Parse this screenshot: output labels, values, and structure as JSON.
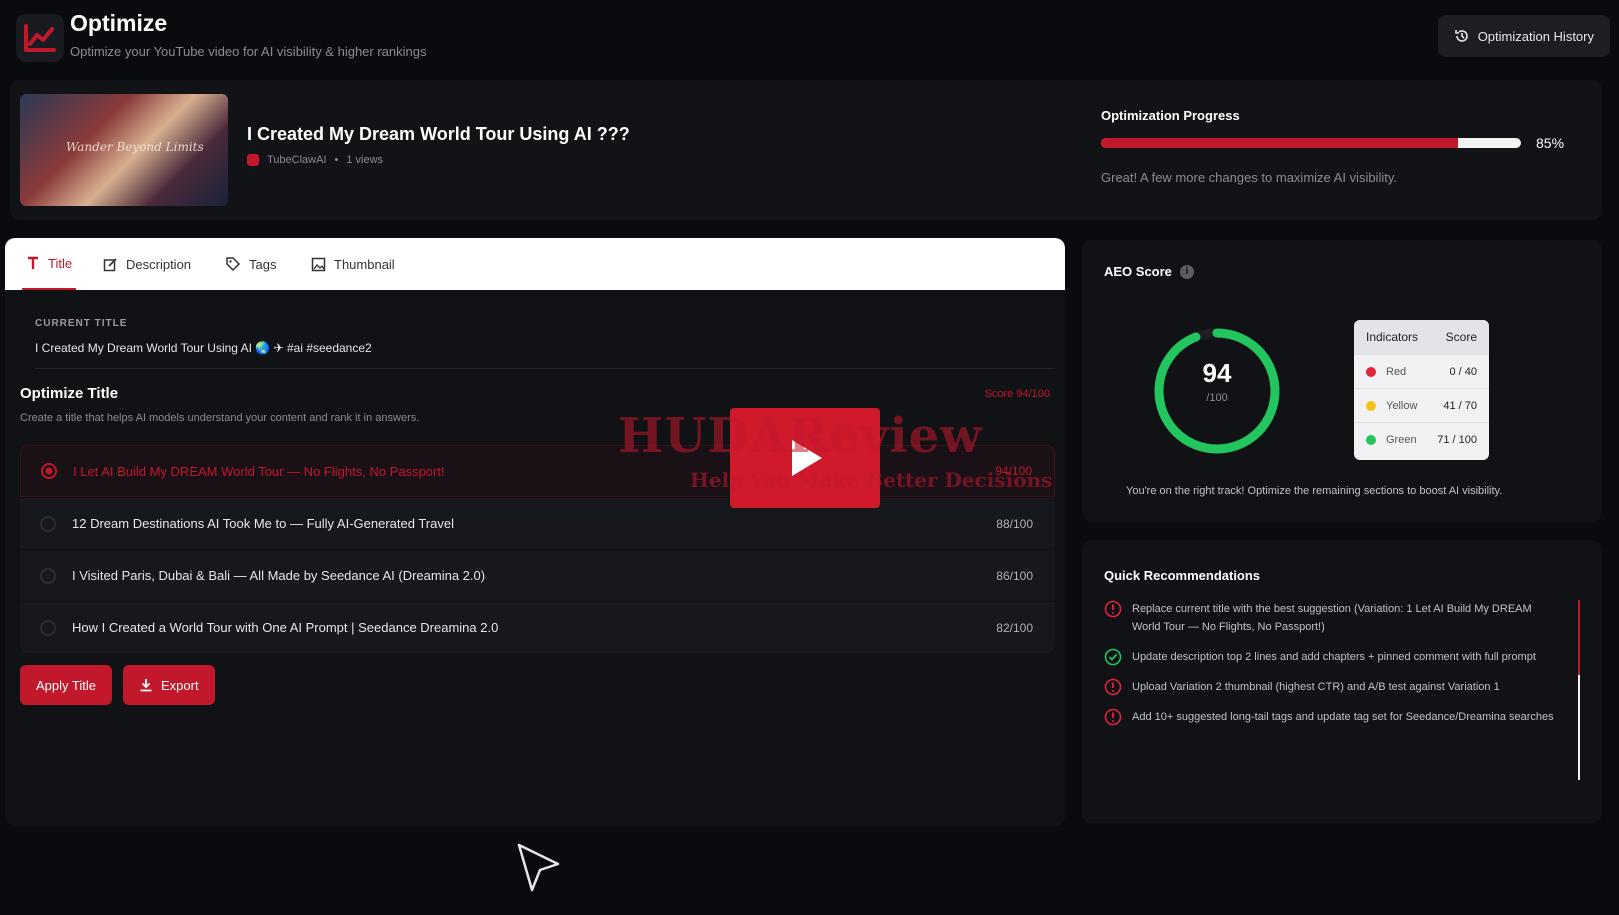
{
  "header": {
    "title": "Optimize",
    "subtitle": "Optimize your YouTube video for AI visibility & higher rankings",
    "history_button": "Optimization History",
    "icon": "line-chart-icon"
  },
  "video": {
    "title": "I Created My Dream World Tour Using AI ???",
    "thumbnail_text": "Wander Beyond Limits",
    "channel": "TubeClawAI",
    "views": "1 views"
  },
  "progress": {
    "label": "Optimization Progress",
    "percent": 85,
    "percent_text": "85%",
    "note": "Great! A few more changes to maximize AI visibility."
  },
  "tabs": [
    {
      "label": "Title",
      "icon": "text-icon",
      "active": true
    },
    {
      "label": "Description",
      "icon": "edit-icon",
      "active": false
    },
    {
      "label": "Tags",
      "icon": "tag-icon",
      "active": false
    },
    {
      "label": "Thumbnail",
      "icon": "image-icon",
      "active": false
    }
  ],
  "editor": {
    "current_label": "CURRENT TITLE",
    "current_value": "I Created My Dream World Tour Using AI 🌏 ✈ #ai #seedance2",
    "section_title": "Optimize Title",
    "section_score": "Score 94/100",
    "section_sub": "Create a title that helps AI models understand your content and rank it in answers.",
    "options": [
      {
        "text": "I Let AI Build My DREAM World Tour — No Flights, No Passport!",
        "score": "94/100",
        "selected": true
      },
      {
        "text": "12 Dream Destinations AI Took Me to — Fully AI-Generated Travel",
        "score": "88/100",
        "selected": false
      },
      {
        "text": "I Visited Paris, Dubai & Bali — All Made by Seedance AI (Dreamina 2.0)",
        "score": "86/100",
        "selected": false
      },
      {
        "text": "How I Created a World Tour with One AI Prompt | Seedance Dreamina 2.0",
        "score": "82/100",
        "selected": false
      }
    ],
    "apply_button": "Apply Title",
    "export_button": "Export"
  },
  "aeo": {
    "title": "AEO Score",
    "score": "94",
    "score_value": 94,
    "score_max": "/100",
    "table_headers": [
      "Indicators",
      "Score"
    ],
    "indicators": [
      {
        "name": "Red",
        "score": "0 / 40",
        "color": "#e0243c"
      },
      {
        "name": "Yellow",
        "score": "41 / 70",
        "color": "#f2c418"
      },
      {
        "name": "Green",
        "score": "71 / 100",
        "color": "#22c55e"
      }
    ],
    "note": "You're on the right track! Optimize the remaining sections to boost AI visibility.",
    "ring_color": "#22c55e"
  },
  "recommendations": {
    "title": "Quick Recommendations",
    "items": [
      {
        "text": "Replace current title with the best suggestion (Variation: 1 Let AI Build My DREAM World Tour — No Flights, No Passport!)",
        "status": "alert"
      },
      {
        "text": "Update description top 2 lines and add chapters + pinned comment with full prompt",
        "status": "done"
      },
      {
        "text": "Upload Variation 2 thumbnail (highest CTR) and A/B test against Variation 1",
        "status": "alert"
      },
      {
        "text": "Add 10+ suggested long-tail tags and update tag set for Seedance/Dreamina searches",
        "status": "alert"
      }
    ]
  },
  "overlay": {
    "watermark": "HUDAReview",
    "watermark_sub": "Help You Make Better Decisions"
  },
  "colors": {
    "accent": "#c2182b",
    "background": "#0a0b0e",
    "card": "#111216",
    "success": "#22c55e"
  }
}
